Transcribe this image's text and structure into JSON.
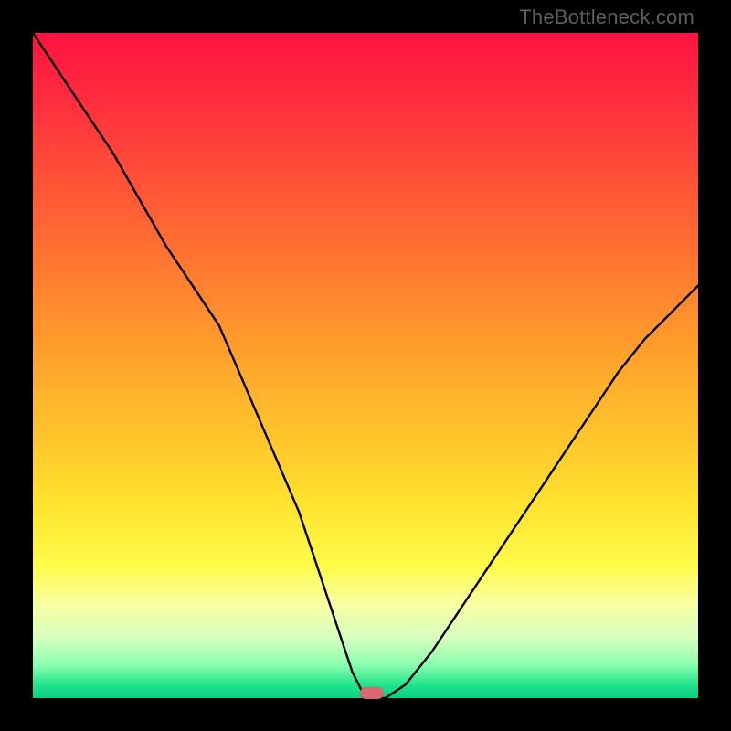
{
  "watermark": "TheBottleneck.com",
  "marker": {
    "x_percent": 51,
    "y_percent": 99.2
  },
  "colors": {
    "frame": "#000000",
    "marker": "#d66a6e",
    "curve": "#000000",
    "gradient_stops": [
      "#ff1240",
      "#ff2d3f",
      "#ff5138",
      "#ff7531",
      "#ff9a2c",
      "#ffbd2c",
      "#ffe02e",
      "#fffb49",
      "#f8ffa3",
      "#d6ffbf",
      "#8affae",
      "#23e38c",
      "#06d181"
    ]
  },
  "chart_data": {
    "type": "line",
    "title": "",
    "xlabel": "",
    "ylabel": "",
    "xlim": [
      0,
      100
    ],
    "ylim": [
      0,
      100
    ],
    "grid": false,
    "legend": false,
    "note": "x,y in percent of plot area; y=0 is bottom (good/green), y=100 is top (bad/red). V-shaped bottleneck curve with minimum near x≈50.",
    "series": [
      {
        "name": "bottleneck-curve",
        "x": [
          0,
          4,
          8,
          12,
          16,
          20,
          24,
          28,
          31,
          34,
          37,
          40,
          42,
          44,
          46,
          48,
          50,
          53,
          56,
          60,
          64,
          68,
          72,
          76,
          80,
          84,
          88,
          92,
          96,
          100
        ],
        "y": [
          100,
          94,
          88,
          82,
          75,
          68,
          62,
          56,
          49,
          42,
          35,
          28,
          22,
          16,
          10,
          4,
          0,
          0,
          2,
          7,
          13,
          19,
          25,
          31,
          37,
          43,
          49,
          54,
          58,
          62
        ]
      }
    ],
    "marker_point": {
      "x": 51,
      "y": 0.8
    }
  }
}
